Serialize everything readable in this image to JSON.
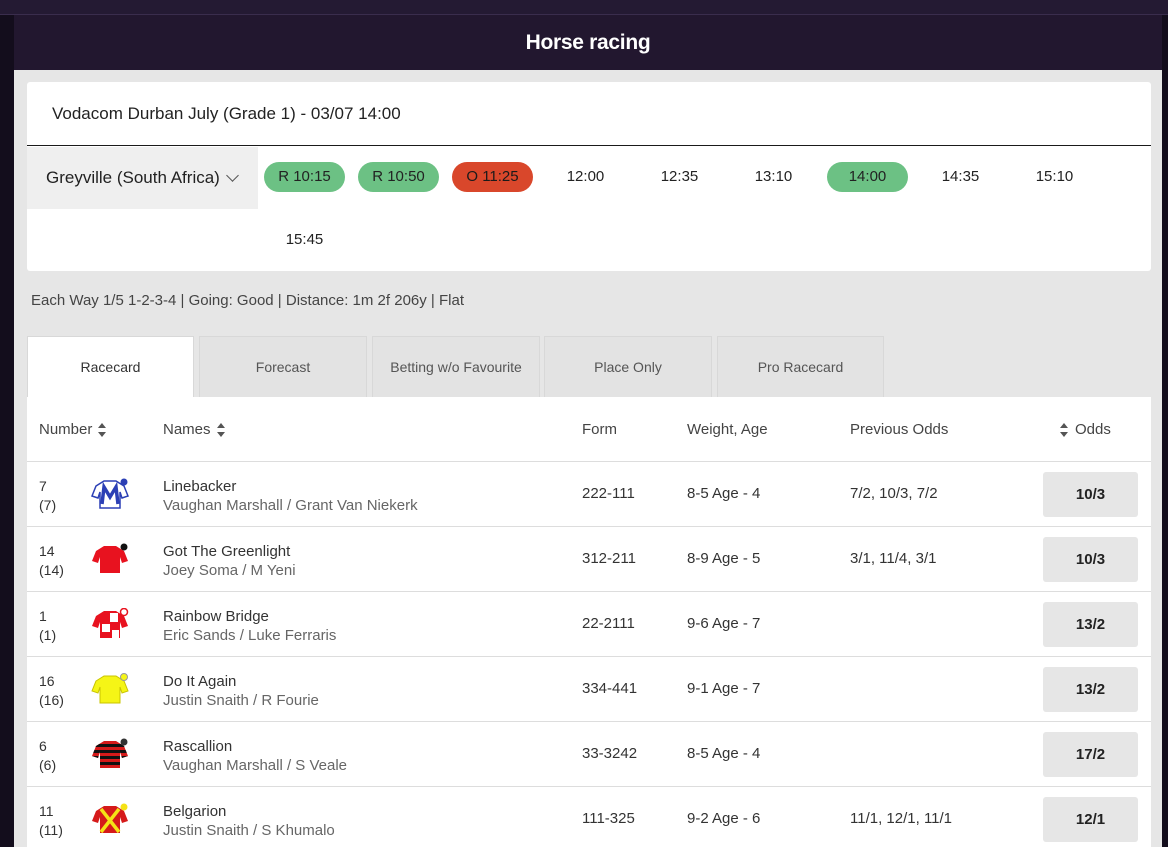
{
  "page": {
    "title": "Horse racing"
  },
  "race": {
    "title": "Vodacom Durban July (Grade 1) - 03/07 14:00",
    "venue": "Greyville (South Africa)",
    "times": [
      {
        "label": "R 10:15",
        "state": "result"
      },
      {
        "label": "R 10:50",
        "state": "result"
      },
      {
        "label": "O 11:25",
        "state": "off"
      },
      {
        "label": "12:00",
        "state": "upcoming"
      },
      {
        "label": "12:35",
        "state": "upcoming"
      },
      {
        "label": "13:10",
        "state": "upcoming"
      },
      {
        "label": "14:00",
        "state": "selected"
      },
      {
        "label": "14:35",
        "state": "upcoming"
      },
      {
        "label": "15:10",
        "state": "upcoming"
      },
      {
        "label": "15:45",
        "state": "upcoming"
      }
    ],
    "info": "Each Way 1/5 1-2-3-4 | Going: Good | Distance: 1m 2f 206y | Flat"
  },
  "tabs": [
    "Racecard",
    "Forecast",
    "Betting w/o Favourite",
    "Place Only",
    "Pro Racecard"
  ],
  "columns": {
    "number": "Number",
    "names": "Names",
    "form": "Form",
    "weight_age": "Weight, Age",
    "previous_odds": "Previous Odds",
    "odds": "Odds"
  },
  "runners": [
    {
      "number": "7",
      "draw": "(7)",
      "horse": "Linebacker",
      "jockey": "Vaughan Marshall / Grant Van Niekerk",
      "form": "222-111",
      "weight_age": "8-5 Age - 4",
      "previous_odds": "7/2, 10/3, 7/2",
      "odds": "10/3",
      "silk": "white-blue-m"
    },
    {
      "number": "14",
      "draw": "(14)",
      "horse": "Got The Greenlight",
      "jockey": "Joey Soma / M Yeni",
      "form": "312-211",
      "weight_age": "8-9 Age - 5",
      "previous_odds": "3/1, 11/4, 3/1",
      "odds": "10/3",
      "silk": "red-black-cap"
    },
    {
      "number": "1",
      "draw": "(1)",
      "horse": "Rainbow Bridge",
      "jockey": "Eric Sands / Luke Ferraris",
      "form": "22-2111",
      "weight_age": "9-6 Age - 7",
      "previous_odds": "",
      "odds": "13/2",
      "silk": "red-white-check"
    },
    {
      "number": "16",
      "draw": "(16)",
      "horse": "Do It Again",
      "jockey": "Justin Snaith / R Fourie",
      "form": "334-441",
      "weight_age": "9-1 Age - 7",
      "previous_odds": "",
      "odds": "13/2",
      "silk": "yellow"
    },
    {
      "number": "6",
      "draw": "(6)",
      "horse": "Rascallion",
      "jockey": "Vaughan Marshall / S Veale",
      "form": "33-3242",
      "weight_age": "8-5 Age - 4",
      "previous_odds": "",
      "odds": "17/2",
      "silk": "red-black-hoops"
    },
    {
      "number": "11",
      "draw": "(11)",
      "horse": "Belgarion",
      "jockey": "Justin Snaith / S Khumalo",
      "form": "111-325",
      "weight_age": "9-2 Age - 6",
      "previous_odds": "11/1, 12/1, 11/1",
      "odds": "12/1",
      "silk": "red-yellow-cross"
    }
  ]
}
